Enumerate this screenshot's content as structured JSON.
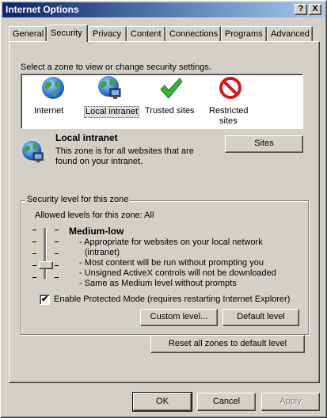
{
  "window": {
    "title": "Internet Options",
    "help_glyph": "?",
    "close_glyph": "X"
  },
  "tabs": [
    {
      "label": "General"
    },
    {
      "label": "Security"
    },
    {
      "label": "Privacy"
    },
    {
      "label": "Content"
    },
    {
      "label": "Connections"
    },
    {
      "label": "Programs"
    },
    {
      "label": "Advanced"
    }
  ],
  "security": {
    "instruction": "Select a zone to view or change security settings.",
    "zones": [
      {
        "label": "Internet",
        "icon": "globe-icon"
      },
      {
        "label": "Local intranet",
        "icon": "intranet-globe-icon"
      },
      {
        "label": "Trusted sites",
        "icon": "checkmark-icon"
      },
      {
        "label": "Restricted",
        "label2": "sites",
        "icon": "restricted-icon"
      }
    ],
    "selected_zone": {
      "name": "Local intranet",
      "desc1": "This zone is for all websites that are",
      "desc2": "found on your intranet."
    },
    "sites_button": "Sites",
    "group_title": "Security level for this zone",
    "allowed_levels": "Allowed levels for this zone: All",
    "slider": {
      "level_index": 1,
      "level_count": 5
    },
    "level_name": "Medium-low",
    "level_bullets": [
      "- Appropriate for websites on your local network",
      "(intranet)",
      "- Most content will be run without prompting you",
      "- Unsigned ActiveX controls will not be downloaded",
      "- Same as Medium level without prompts"
    ],
    "protected_mode": {
      "label": "Enable Protected Mode (requires restarting Internet Explorer)",
      "checked": true
    },
    "custom_level_button": "Custom level...",
    "default_level_button": "Default level",
    "reset_all_button": "Reset all zones to default level"
  },
  "footer": {
    "ok": "OK",
    "cancel": "Cancel",
    "apply": "Apply"
  },
  "colors": {
    "titlebar_start": "#0a246a",
    "titlebar_end": "#a6caf0",
    "face": "#d4d0c8"
  }
}
